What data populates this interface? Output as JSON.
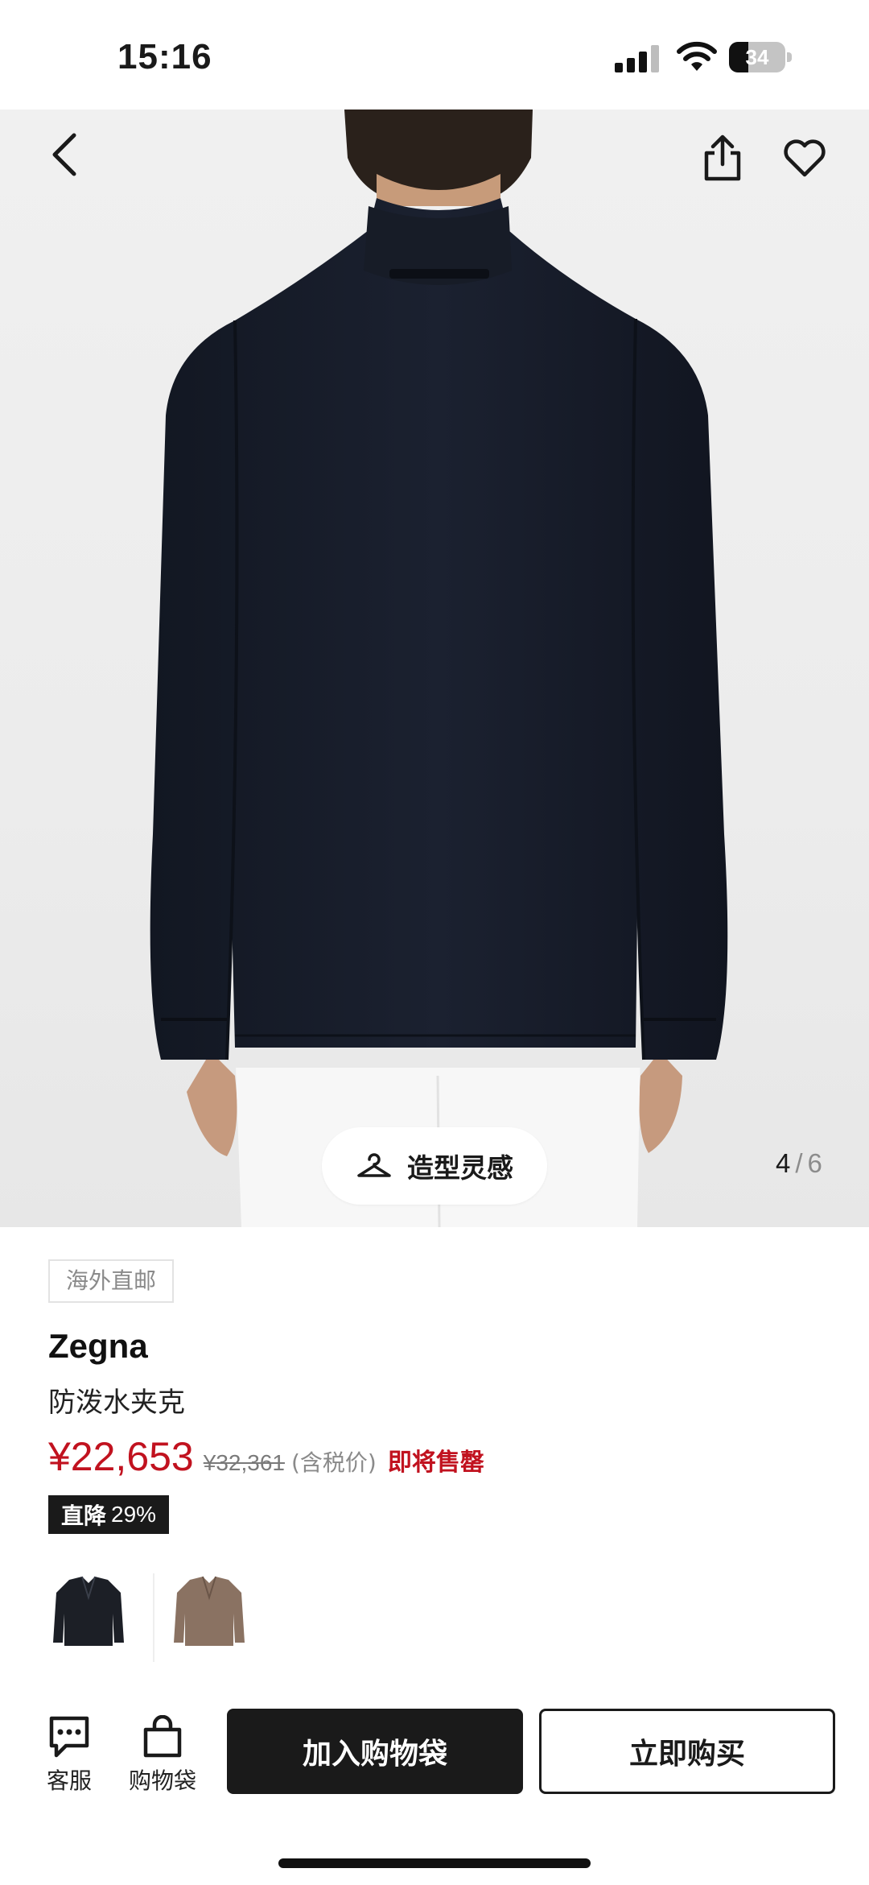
{
  "status_bar": {
    "time": "15:16",
    "battery_level": "34",
    "battery_fraction": 0.34
  },
  "hero": {
    "nav": {
      "back_icon": "chevron-left-icon",
      "share_icon": "share-icon",
      "favorite_icon": "heart-icon"
    },
    "inspiration_label": "造型灵感",
    "inspiration_icon": "hanger-icon",
    "image_index": "4",
    "image_separator": "/",
    "image_total": "6"
  },
  "product": {
    "tag": "海外直邮",
    "brand": "Zegna",
    "name": "防泼水夹克",
    "price": "¥22,653",
    "original_price": "¥32,361",
    "tax_note": "(含税价)",
    "stock_note": "即将售罄",
    "discount_label": "直降",
    "discount_percent": "29%",
    "variants": [
      {
        "color_name": "navy",
        "swatch_color": "#1c1f26"
      },
      {
        "color_name": "taupe",
        "swatch_color": "#8a7262"
      }
    ]
  },
  "actions": {
    "customer_service_label": "客服",
    "bag_label": "购物袋",
    "add_to_bag_label": "加入购物袋",
    "buy_now_label": "立即购买"
  },
  "colors": {
    "accent_red": "#c1121f",
    "primary_dark": "#1a1a1a",
    "muted_text": "#8a8a8a"
  }
}
